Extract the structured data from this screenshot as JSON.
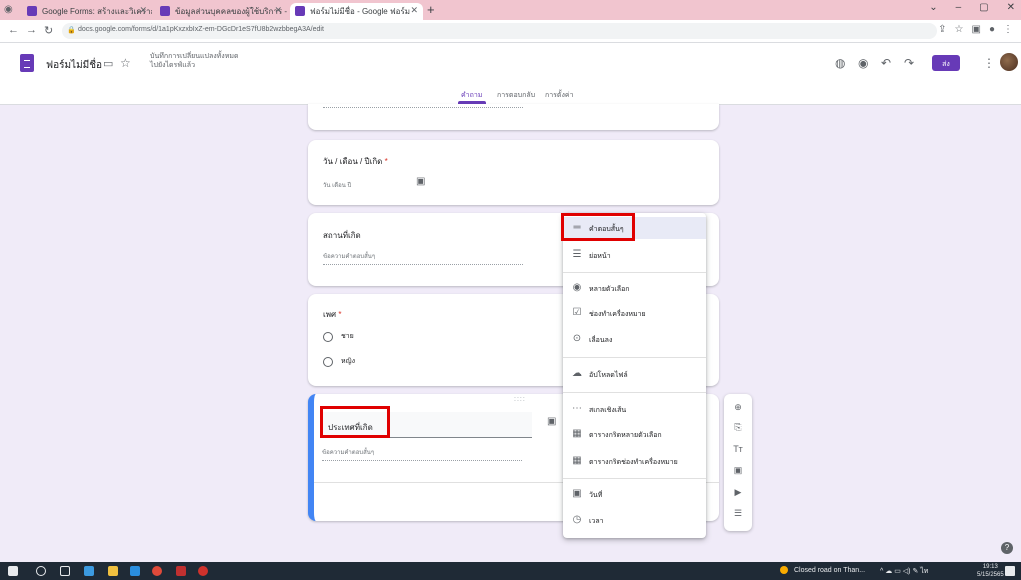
{
  "browser": {
    "tabs": [
      {
        "label": "Google Forms: สร้างและวิเคราะห์แบบสำรวจ",
        "favicon_color": "#673ab7",
        "active": false
      },
      {
        "label": "ข้อมูลส่วนบุคคลของผู้ใช้บริการ - Goog",
        "favicon_color": "#673ab7",
        "active": false
      },
      {
        "label": "ฟอร์มไม่มีชื่อ - Google ฟอร์ม",
        "favicon_color": "#673ab7",
        "active": true
      }
    ],
    "new_tab": "+",
    "url": "docs.google.com/forms/d/1a1pKxzxbIxZ-em-DGcDr1eS7fU8b2wzbbegA3A/edit",
    "window_controls": [
      "⌄",
      "–",
      "▢",
      "✕"
    ]
  },
  "header": {
    "form_title": "ฟอร์มไม่มีชื่อ",
    "saved_status": "บันทึกการเปลี่ยนแปลงทั้งหมด ไปยังไดรฟ์แล้ว",
    "send_label": "ส่ง",
    "tabs": [
      {
        "label": "คำถาม",
        "active": true
      },
      {
        "label": "การตอบกลับ",
        "active": false
      },
      {
        "label": "การตั้งค่า",
        "active": false
      }
    ]
  },
  "form": {
    "date_question": {
      "title": "วัน / เดือน / ปีเกิด",
      "required_mark": "*",
      "placeholder": "วัน เดือน ปี"
    },
    "birthplace_question": {
      "title": "สถานที่เกิด",
      "answer_hint": "ข้อความคำตอบสั้นๆ"
    },
    "gender_question": {
      "title": "เพศ",
      "required_mark": "*",
      "options": [
        "ชาย",
        "หญิง"
      ]
    },
    "active_question": {
      "drag_handle": "::::",
      "title": "ประเทศที่เกิด",
      "answer_hint": "ข้อความคำตอบสั้นๆ"
    }
  },
  "type_menu": {
    "items": [
      {
        "label": "คำตอบสั้นๆ",
        "icon": "short-answer-icon",
        "glyph": "═",
        "selected": true
      },
      {
        "label": "ย่อหน้า",
        "icon": "paragraph-icon",
        "glyph": "☰",
        "selected": false
      },
      {
        "label": "หลายตัวเลือก",
        "icon": "radio-icon",
        "glyph": "◉",
        "selected": false
      },
      {
        "label": "ช่องทำเครื่องหมาย",
        "icon": "checkbox-icon",
        "glyph": "☑",
        "selected": false
      },
      {
        "label": "เลื่อนลง",
        "icon": "dropdown-icon",
        "glyph": "⊙",
        "selected": false
      },
      {
        "label": "อัปโหลดไฟล์",
        "icon": "upload-icon",
        "glyph": "☁",
        "selected": false
      },
      {
        "label": "สเกลเชิงเส้น",
        "icon": "linear-scale-icon",
        "glyph": "⋯",
        "selected": false
      },
      {
        "label": "ตารางกริดหลายตัวเลือก",
        "icon": "grid-icon",
        "glyph": "▦",
        "selected": false
      },
      {
        "label": "ตารางกริดช่องทำเครื่องหมาย",
        "icon": "checkbox-grid-icon",
        "glyph": "▦",
        "selected": false
      },
      {
        "label": "วันที่",
        "icon": "calendar-icon",
        "glyph": "▣",
        "selected": false
      },
      {
        "label": "เวลา",
        "icon": "clock-icon",
        "glyph": "◷",
        "selected": false
      }
    ]
  },
  "floating_toolbar": [
    "⊕",
    "⎘",
    "Tт",
    "▣",
    "▶",
    "☰"
  ],
  "taskbar": {
    "weather": "Closed road on Than...",
    "language": "ไท",
    "clock_time": "19:13",
    "clock_date": "5/15/2565"
  },
  "colors": {
    "brand": "#673ab7",
    "canvas": "#f0ebf8",
    "highlight": "#e00000",
    "active_border": "#4285f4"
  }
}
